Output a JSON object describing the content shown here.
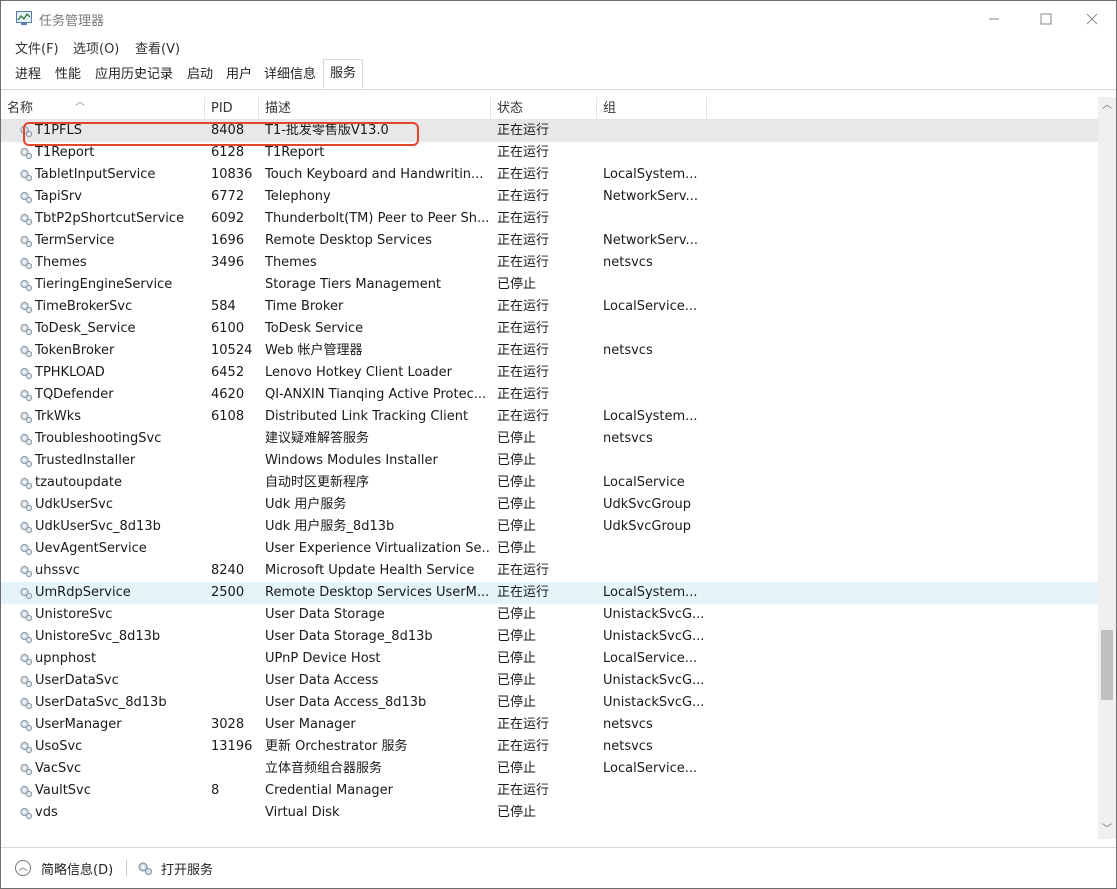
{
  "window": {
    "title": "任务管理器"
  },
  "menu": [
    "文件(F)",
    "选项(O)",
    "查看(V)"
  ],
  "tabs": [
    "进程",
    "性能",
    "应用历史记录",
    "启动",
    "用户",
    "详细信息",
    "服务"
  ],
  "columns": [
    "名称",
    "PID",
    "描述",
    "状态",
    "组"
  ],
  "rows": [
    [
      "T1PFLS",
      "8408",
      "T1-批发零售版V13.0",
      "正在运行",
      ""
    ],
    [
      "T1Report",
      "6128",
      "T1Report",
      "正在运行",
      ""
    ],
    [
      "TabletInputService",
      "10836",
      "Touch Keyboard and Handwritin...",
      "正在运行",
      "LocalSystem..."
    ],
    [
      "TapiSrv",
      "6772",
      "Telephony",
      "正在运行",
      "NetworkServ..."
    ],
    [
      "TbtP2pShortcutService",
      "6092",
      "Thunderbolt(TM) Peer to Peer Sh...",
      "正在运行",
      ""
    ],
    [
      "TermService",
      "1696",
      "Remote Desktop Services",
      "正在运行",
      "NetworkServ..."
    ],
    [
      "Themes",
      "3496",
      "Themes",
      "正在运行",
      "netsvcs"
    ],
    [
      "TieringEngineService",
      "",
      "Storage Tiers Management",
      "已停止",
      ""
    ],
    [
      "TimeBrokerSvc",
      "584",
      "Time Broker",
      "正在运行",
      "LocalService..."
    ],
    [
      "ToDesk_Service",
      "6100",
      "ToDesk Service",
      "正在运行",
      ""
    ],
    [
      "TokenBroker",
      "10524",
      "Web 帐户管理器",
      "正在运行",
      "netsvcs"
    ],
    [
      "TPHKLOAD",
      "6452",
      "Lenovo Hotkey Client Loader",
      "正在运行",
      ""
    ],
    [
      "TQDefender",
      "4620",
      "QI-ANXIN Tianqing Active Protec...",
      "正在运行",
      ""
    ],
    [
      "TrkWks",
      "6108",
      "Distributed Link Tracking Client",
      "正在运行",
      "LocalSystem..."
    ],
    [
      "TroubleshootingSvc",
      "",
      "建议疑难解答服务",
      "已停止",
      "netsvcs"
    ],
    [
      "TrustedInstaller",
      "",
      "Windows Modules Installer",
      "已停止",
      ""
    ],
    [
      "tzautoupdate",
      "",
      "自动时区更新程序",
      "已停止",
      "LocalService"
    ],
    [
      "UdkUserSvc",
      "",
      "Udk 用户服务",
      "已停止",
      "UdkSvcGroup"
    ],
    [
      "UdkUserSvc_8d13b",
      "",
      "Udk 用户服务_8d13b",
      "已停止",
      "UdkSvcGroup"
    ],
    [
      "UevAgentService",
      "",
      "User Experience Virtualization Se...",
      "已停止",
      ""
    ],
    [
      "uhssvc",
      "8240",
      "Microsoft Update Health Service",
      "正在运行",
      ""
    ],
    [
      "UmRdpService",
      "2500",
      "Remote Desktop Services UserM...",
      "正在运行",
      "LocalSystem..."
    ],
    [
      "UnistoreSvc",
      "",
      "User Data Storage",
      "已停止",
      "UnistackSvcG..."
    ],
    [
      "UnistoreSvc_8d13b",
      "",
      "User Data Storage_8d13b",
      "已停止",
      "UnistackSvcG..."
    ],
    [
      "upnphost",
      "",
      "UPnP Device Host",
      "已停止",
      "LocalService..."
    ],
    [
      "UserDataSvc",
      "",
      "User Data Access",
      "已停止",
      "UnistackSvcG..."
    ],
    [
      "UserDataSvc_8d13b",
      "",
      "User Data Access_8d13b",
      "已停止",
      "UnistackSvcG..."
    ],
    [
      "UserManager",
      "3028",
      "User Manager",
      "正在运行",
      "netsvcs"
    ],
    [
      "UsoSvc",
      "13196",
      "更新 Orchestrator 服务",
      "正在运行",
      "netsvcs"
    ],
    [
      "VacSvc",
      "",
      "立体音频组合器服务",
      "已停止",
      "LocalService..."
    ],
    [
      "VaultSvc",
      "8",
      "Credential Manager",
      "正在运行",
      ""
    ],
    [
      "vds",
      "",
      "Virtual Disk",
      "已停止",
      ""
    ]
  ],
  "selected_row": 0,
  "hover_row": 21,
  "footer": {
    "less_details": "简略信息(D)",
    "open_services": "打开服务"
  },
  "icons": {
    "app": "task-manager-icon",
    "service": "gear-service-icon",
    "sort": "sort-ascending-icon"
  },
  "colors": {
    "highlight_box": "#e2452d",
    "selected_row": "#e8e8e8",
    "hover_row": "#e5f3fb"
  }
}
